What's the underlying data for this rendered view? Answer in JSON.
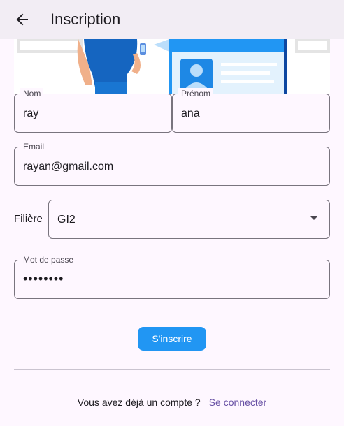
{
  "appbar": {
    "title": "Inscription",
    "back_icon": "arrow-back-icon"
  },
  "hero": {
    "icon": "registration-illustration"
  },
  "form": {
    "nom": {
      "label": "Nom",
      "value": "ray"
    },
    "prenom": {
      "label": "Prénom",
      "value": "ana"
    },
    "email": {
      "label": "Email",
      "value": "rayan@gmail.com"
    },
    "filiere": {
      "label": "Filière",
      "value": "GI2"
    },
    "password": {
      "label": "Mot de passe",
      "value": "••••••••"
    },
    "submit_label": "S'inscrire"
  },
  "footer": {
    "text": "Vous avez déjà un compte ?",
    "link": "Se connecter"
  },
  "colors": {
    "background": "#fef7ff",
    "appbar": "#f2edf4",
    "primary_button": "#2196f3",
    "link": "#6750a4",
    "outline": "#79747e"
  }
}
